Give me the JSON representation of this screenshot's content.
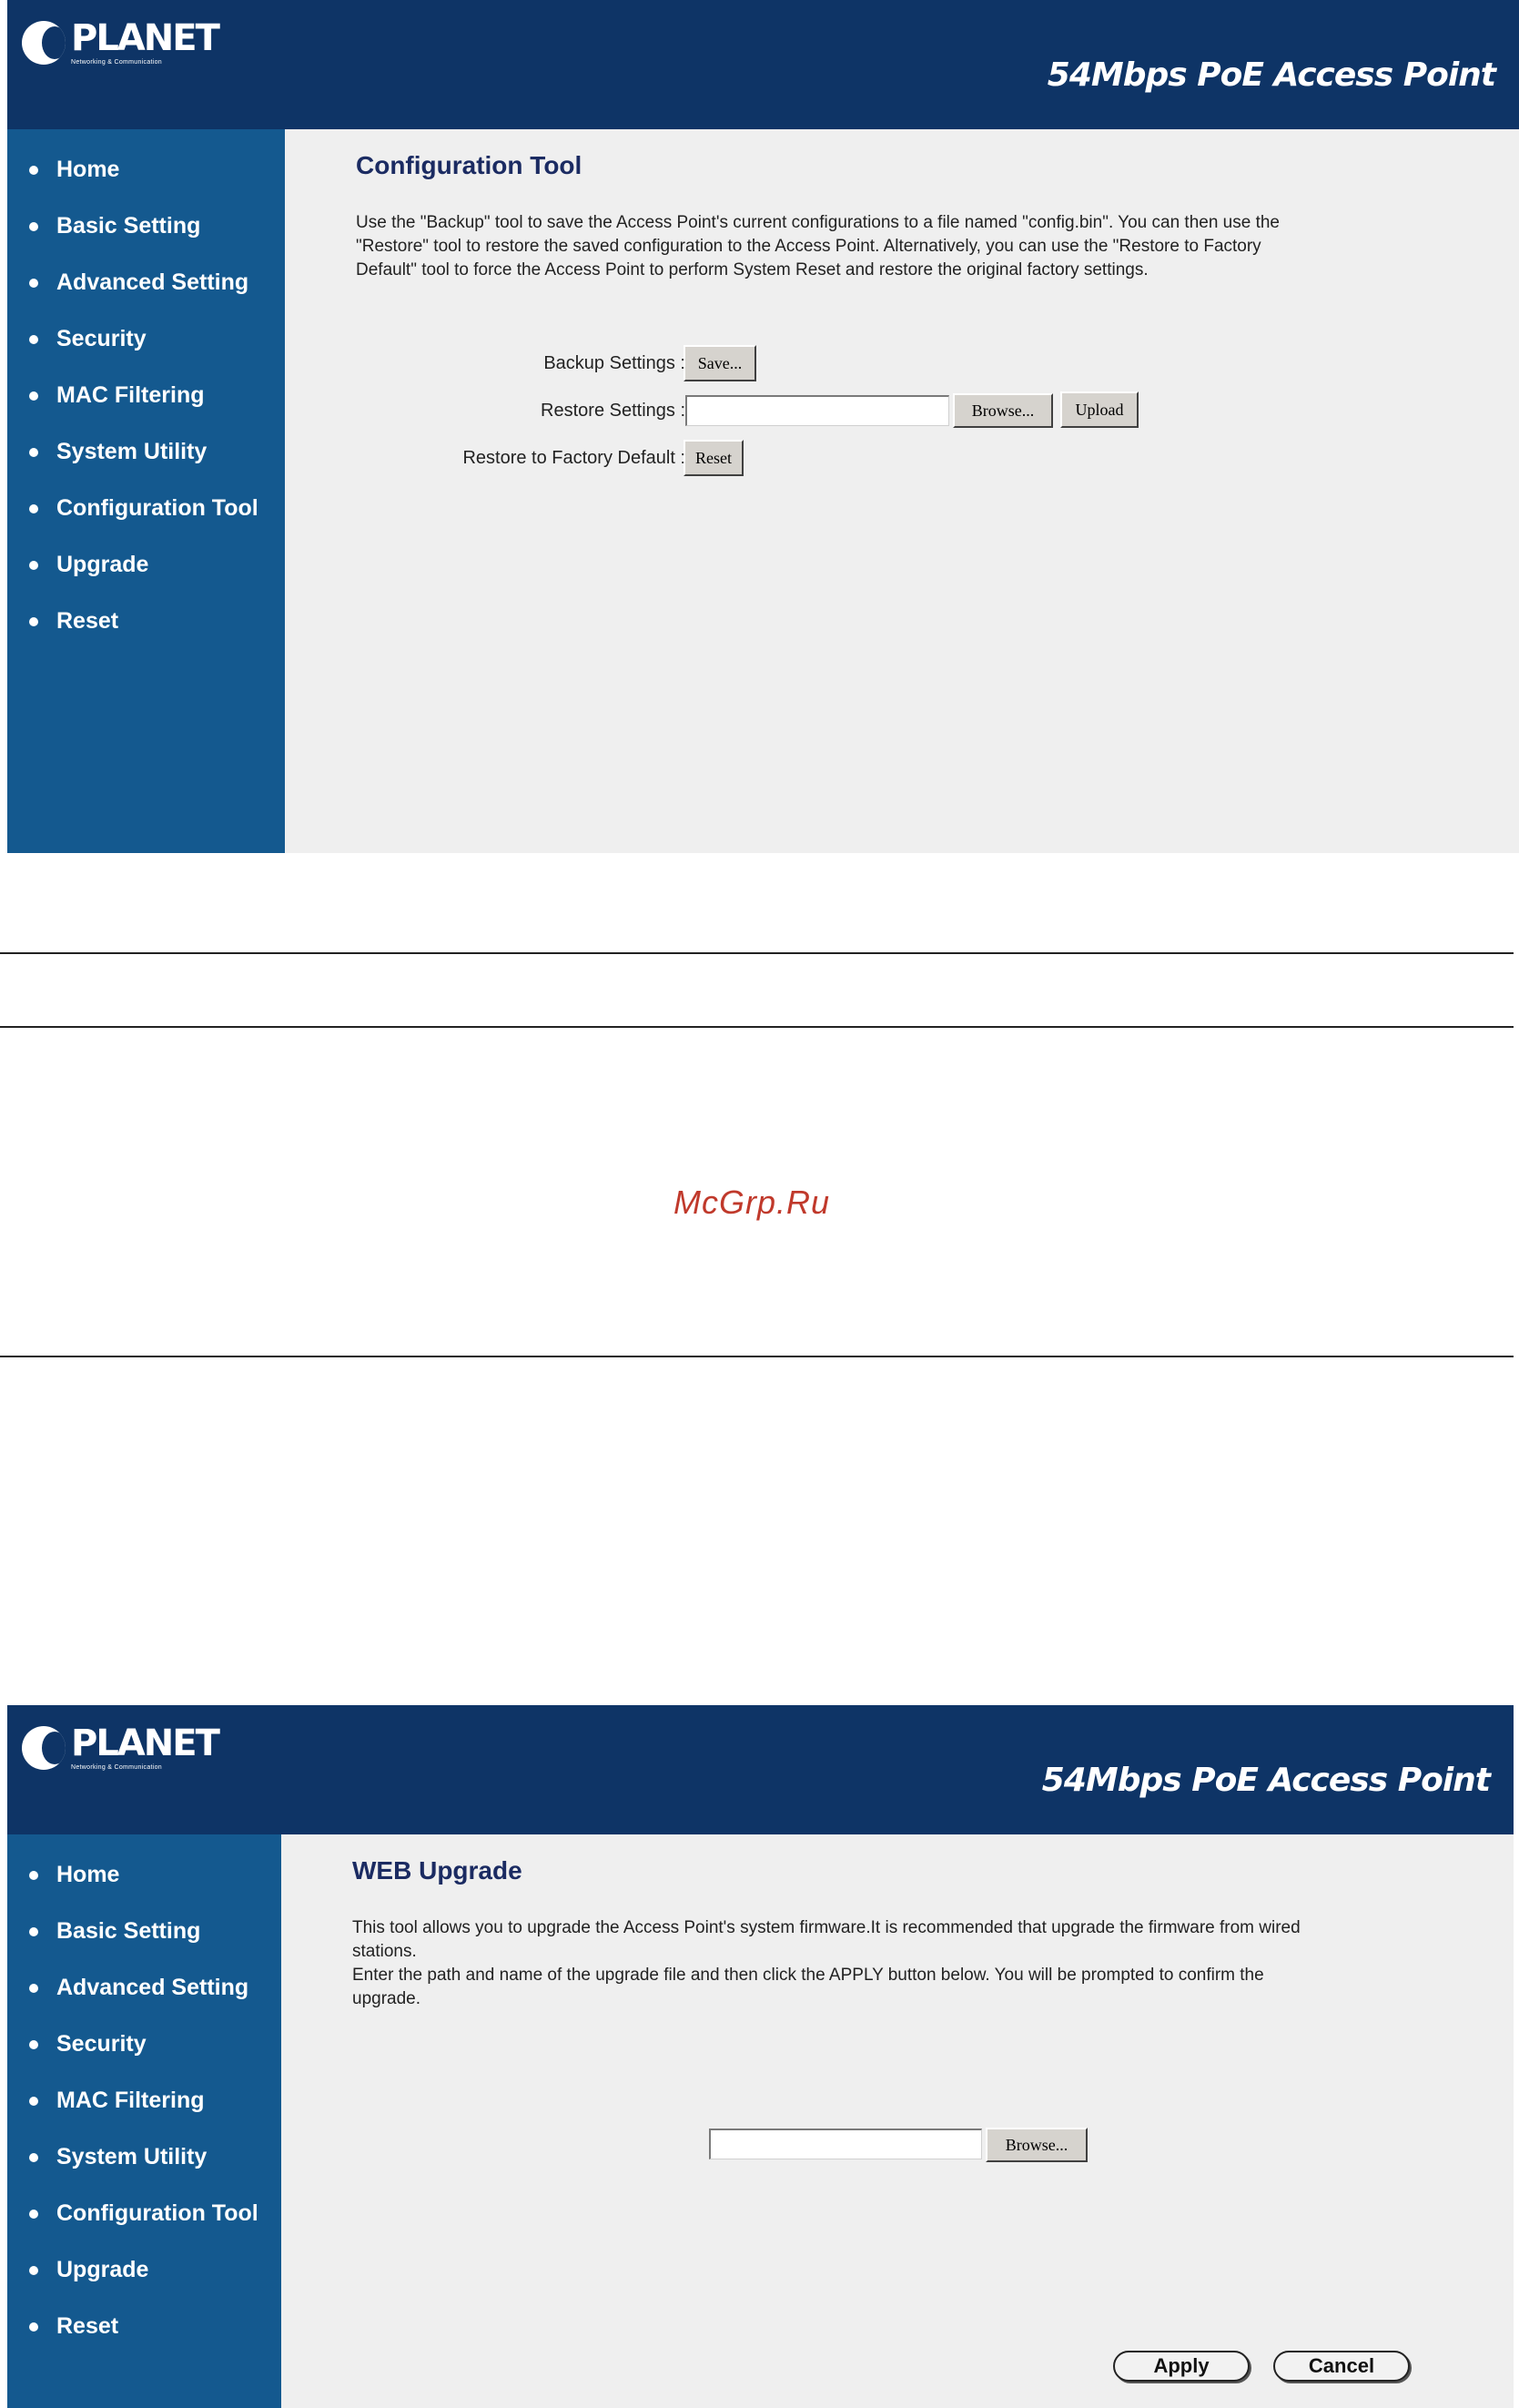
{
  "screen1": {
    "logo": {
      "name": "PLANET",
      "tagline": "Networking & Communication"
    },
    "product_title": "54Mbps PoE Access Point",
    "nav": [
      "Home",
      "Basic Setting",
      "Advanced Setting",
      "Security",
      "MAC Filtering",
      "System Utility",
      "Configuration Tool",
      "Upgrade",
      "Reset"
    ],
    "page_title": "Configuration Tool",
    "description": [
      "Use the \"Backup\" tool to save the Access Point's current configurations to a file named \"config.bin\". You can then use the",
      "\"Restore\" tool to restore the saved configuration to the Access Point. Alternatively, you can use the \"Restore to Factory",
      "Default\" tool to force the Access Point to perform System Reset and restore the original factory settings."
    ],
    "backup_label": "Backup Settings :",
    "save_button": "Save...",
    "restore_label": "Restore Settings :",
    "browse_button": "Browse...",
    "upload_button": "Upload",
    "factory_label": "Restore to Factory Default :",
    "reset_button": "Reset"
  },
  "watermark": "McGrp.Ru",
  "screen2": {
    "logo": {
      "name": "PLANET",
      "tagline": "Networking & Communication"
    },
    "product_title": "54Mbps PoE Access Point",
    "nav": [
      "Home",
      "Basic Setting",
      "Advanced Setting",
      "Security",
      "MAC Filtering",
      "System Utility",
      "Configuration Tool",
      "Upgrade",
      "Reset"
    ],
    "page_title": "WEB Upgrade",
    "description": [
      "This tool allows you to upgrade the Access Point's system firmware.It is recommended that upgrade the firmware from wired",
      "stations.",
      "Enter the path and name of the upgrade file and then click the APPLY button below. You will be prompted to confirm the",
      "upgrade."
    ],
    "browse_button": "Browse...",
    "apply_button": "Apply",
    "cancel_button": "Cancel"
  },
  "colors": {
    "banner": "#0e3466",
    "sidebar": "#14598f",
    "content_bg": "#efefef",
    "title": "#1b2b62",
    "watermark": "#c0392b"
  }
}
